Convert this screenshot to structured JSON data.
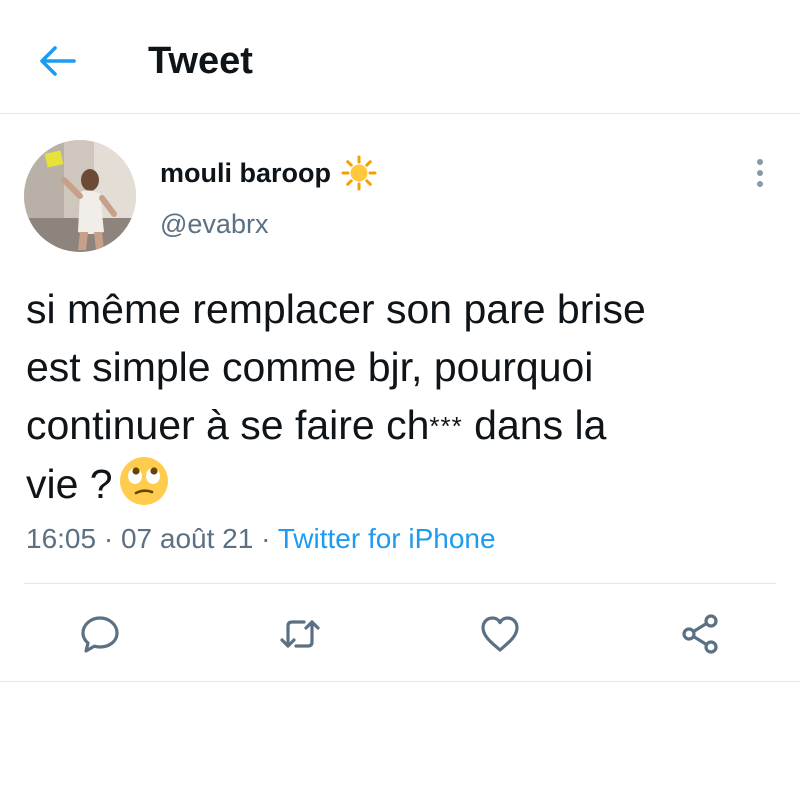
{
  "header": {
    "title": "Tweet",
    "back_icon": "arrow-left-icon"
  },
  "author": {
    "display_name": "mouli baroop",
    "name_emoji": "sun-emoji",
    "handle": "@evabrx"
  },
  "tweet": {
    "lines": [
      "si même remplacer son pare brise",
      "est simple comme bjr, pourquoi",
      "continuer à se faire ch",
      "vie ?"
    ],
    "censor": "***",
    "after_censor": " dans la",
    "end_emoji": "face-with-rolling-eyes-emoji"
  },
  "meta": {
    "time": "16:05",
    "separator1": " · ",
    "date": "07 août 21",
    "separator2": " · ",
    "source": "Twitter for iPhone"
  },
  "actions": {
    "reply_icon": "reply-icon",
    "retweet_icon": "retweet-icon",
    "like_icon": "heart-icon",
    "share_icon": "share-icon"
  },
  "colors": {
    "accent": "#1d9bf0",
    "text": "#0f1419",
    "secondary": "#5b7083",
    "icon": "#5b7083",
    "border": "#e1e6ea"
  }
}
